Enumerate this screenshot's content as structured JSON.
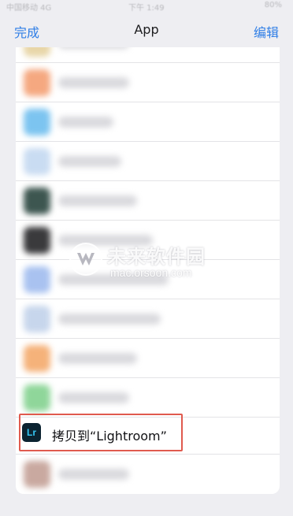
{
  "status_bar": {
    "carrier": "中国移动 4G",
    "time": "下午 1:49",
    "battery": "80%"
  },
  "nav": {
    "done_label": "完成",
    "title": "App",
    "edit_label": "编辑"
  },
  "blurred_rows": [
    {
      "icon_color": "#e8d6a8"
    },
    {
      "icon_color": "#f5a880"
    },
    {
      "icon_color": "#7cc4f0"
    },
    {
      "icon_color": "#c9dcf2"
    },
    {
      "icon_color": "#3d5650"
    },
    {
      "icon_color": "#3a3a3c"
    },
    {
      "icon_color": "#a9c2f0"
    },
    {
      "icon_color": "#c7d6ec"
    },
    {
      "icon_color": "#f5b27a"
    },
    {
      "icon_color": "#8fd69a"
    }
  ],
  "highlighted_action": {
    "icon_text": "Lr",
    "label": "拷贝到“Lightroom”",
    "icon_bg": "#0c2331",
    "icon_fg": "#35c7f5"
  },
  "last_row": {
    "icon_color": "#c9a9a0"
  },
  "watermark": {
    "brand": "未来软件园",
    "url": "mac.orsoon.com"
  },
  "colors": {
    "accent": "#2f7ee6",
    "highlight_border": "#e05a4e"
  }
}
